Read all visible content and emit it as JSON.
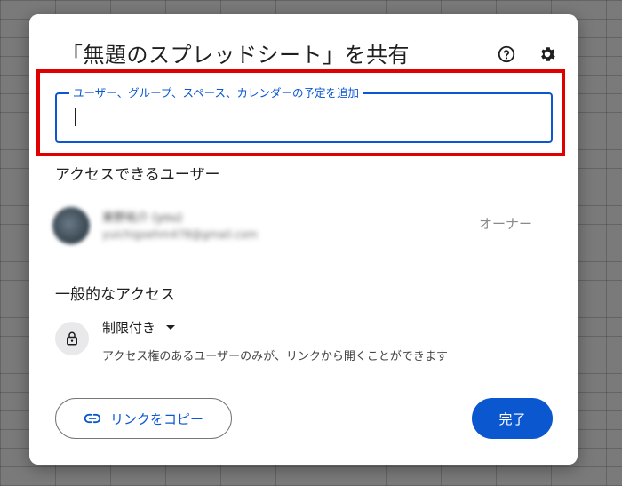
{
  "dialog": {
    "title": "「無題のスプレッドシート」を共有",
    "help_icon": "help-circle-icon",
    "settings_icon": "gear-icon"
  },
  "share_input": {
    "label": "ユーザー、グループ、スペース、カレンダーの予定を追加",
    "value": ""
  },
  "people_section": {
    "heading": "アクセスできるユーザー",
    "users": [
      {
        "name": "東野祐介 (you)",
        "email": "yuichigoehm478@gmail.com",
        "role": "オーナー"
      }
    ]
  },
  "general_access": {
    "heading": "一般的なアクセス",
    "icon": "lock-icon",
    "level": "制限付き",
    "description": "アクセス権のあるユーザーのみが、リンクから開くことができます"
  },
  "footer": {
    "copy_link_label": "リンクをコピー",
    "copy_link_icon": "link-icon",
    "done_label": "完了"
  },
  "colors": {
    "accent": "#0b57d0",
    "highlight": "#e00000"
  }
}
